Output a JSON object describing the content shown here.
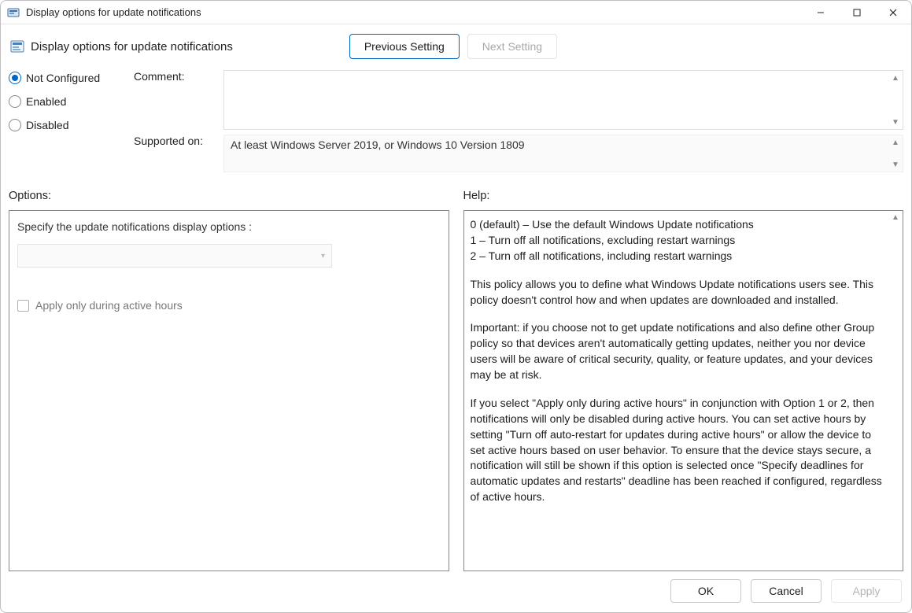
{
  "window_title": "Display options for update notifications",
  "header": {
    "policy_title": "Display options for update notifications",
    "previous_setting_label": "Previous Setting",
    "next_setting_label": "Next Setting"
  },
  "radios": {
    "not_configured": "Not Configured",
    "enabled": "Enabled",
    "disabled": "Disabled",
    "selected": "not_configured"
  },
  "fields": {
    "comment_label": "Comment:",
    "supported_label": "Supported on:",
    "supported_value": "At least Windows Server 2019, or Windows 10 Version 1809"
  },
  "sections": {
    "options_label": "Options:",
    "help_label": "Help:"
  },
  "options": {
    "spec_label": "Specify the update notifications display options :",
    "active_hours_label": "Apply only during active hours"
  },
  "help": {
    "line0": "0 (default) – Use the default Windows Update notifications",
    "line1": "1 – Turn off all notifications, excluding restart warnings",
    "line2": "2 – Turn off all notifications, including restart warnings",
    "p2": "This policy allows you to define what Windows Update notifications users see. This policy doesn't control how and when updates are downloaded and installed.",
    "p3": "Important: if you choose not to get update notifications and also define other Group policy so that devices aren't automatically getting updates, neither you nor device users will be aware of critical security, quality, or feature updates, and your devices may be at risk.",
    "p4": "If you select \"Apply only during active hours\" in conjunction with Option 1 or 2, then notifications will only be disabled during active hours. You can set active hours by setting \"Turn off auto-restart for updates during active hours\" or allow the device to set active hours based on user behavior. To ensure that the device stays secure, a notification will still be shown if this option is selected once \"Specify deadlines for automatic updates and restarts\" deadline has been reached if configured, regardless of active hours."
  },
  "footer": {
    "ok": "OK",
    "cancel": "Cancel",
    "apply": "Apply"
  }
}
